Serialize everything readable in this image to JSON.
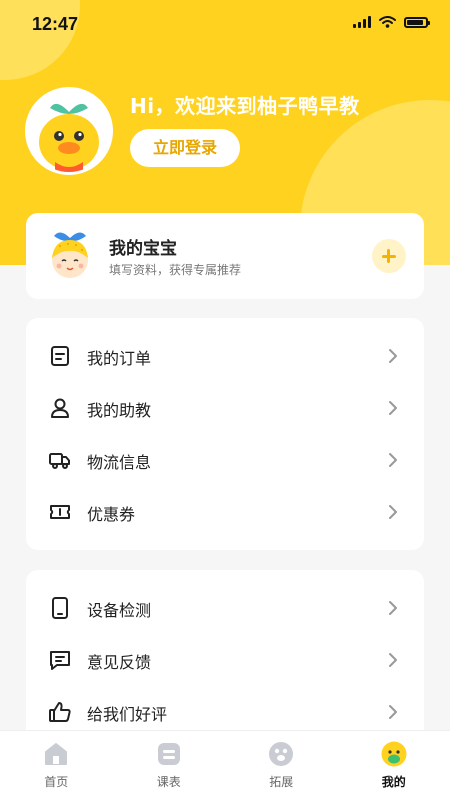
{
  "status_bar": {
    "time": "12:47"
  },
  "header": {
    "greeting": "Hi，欢迎来到柚子鸭早教",
    "login_label": "立即登录"
  },
  "baby_card": {
    "title": "我的宝宝",
    "subtitle": "填写资料，获得专属推荐"
  },
  "menu_group_1": [
    {
      "label": "我的订单",
      "icon": "order-icon"
    },
    {
      "label": "我的助教",
      "icon": "person-icon"
    },
    {
      "label": "物流信息",
      "icon": "truck-icon"
    },
    {
      "label": "优惠券",
      "icon": "coupon-icon"
    }
  ],
  "menu_group_2": [
    {
      "label": "设备检测",
      "icon": "device-icon"
    },
    {
      "label": "意见反馈",
      "icon": "feedback-icon"
    },
    {
      "label": "给我们好评",
      "icon": "thumbs-up-icon"
    }
  ],
  "tabs": [
    {
      "label": "首页",
      "icon": "home-icon"
    },
    {
      "label": "课表",
      "icon": "schedule-icon"
    },
    {
      "label": "拓展",
      "icon": "explore-icon"
    },
    {
      "label": "我的",
      "icon": "profile-duck-icon",
      "active": true
    }
  ],
  "colors": {
    "brand_yellow": "#ffd21f",
    "accent_text": "#e7a600"
  }
}
